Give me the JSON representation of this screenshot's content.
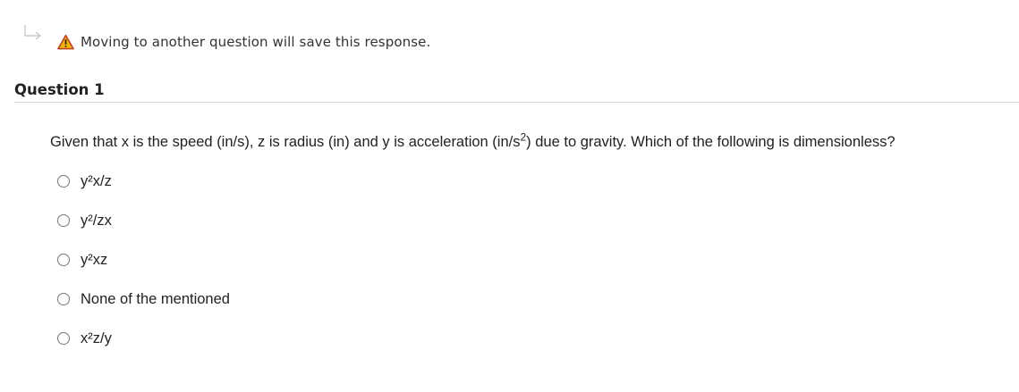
{
  "notice": {
    "icon": "warning-icon",
    "text": "Moving to another question will save this response."
  },
  "question": {
    "title": "Question 1",
    "text_before": "Given that x is the speed (in/s), z is radius (in) and y is acceleration (in/s",
    "text_superscript": "2",
    "text_after": ") due to gravity. Which of the following is dimensionless?"
  },
  "options": [
    {
      "label": "y²x/z"
    },
    {
      "label": "y²/zx"
    },
    {
      "label": "y²xz"
    },
    {
      "label": "None of the mentioned"
    },
    {
      "label": "x²z/y"
    }
  ],
  "colors": {
    "warning_fill": "#f5b400",
    "warning_border": "#c43d1c",
    "text": "#222222",
    "rule": "#d4d4d4"
  }
}
